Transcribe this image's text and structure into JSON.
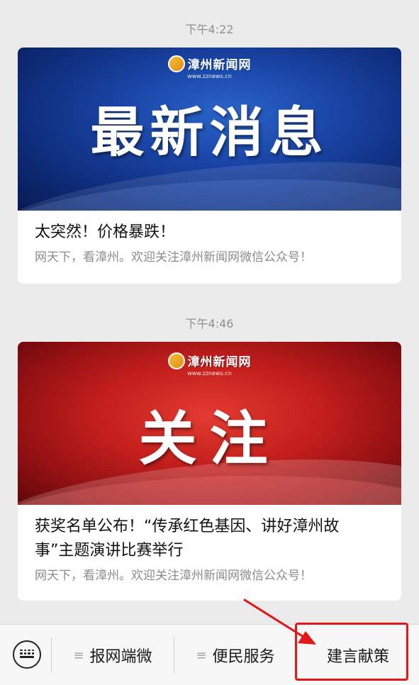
{
  "messages": [
    {
      "time": "下午4:22",
      "logo_text": "漳州新闻网",
      "logo_sub": "www.zznews.cn",
      "banner_text": "最新消息",
      "title": "太突然！价格暴跌！",
      "desc": "网天下，看漳州。欢迎关注漳州新闻网微信公众号！",
      "theme": "blue"
    },
    {
      "time": "下午4:46",
      "logo_text": "漳州新闻网",
      "logo_sub": "www.zznews.cn",
      "banner_text": "关注",
      "title_line1": "获奖名单公布！“传承红色基因、讲好漳州故",
      "title_line2": "事”主题演讲比赛举行",
      "desc": "网天下，看漳州。欢迎关注漳州新闻网微信公众号！",
      "theme": "red"
    }
  ],
  "menu": {
    "keyboard_icon": "keyboard-icon",
    "items": [
      {
        "label": "报网端微",
        "icon": "menu-lines-icon"
      },
      {
        "label": "便民服务",
        "icon": "menu-lines-icon"
      },
      {
        "label": "建言献策"
      }
    ],
    "hamburger_glyph": "≡"
  },
  "annotation": {
    "color": "#e4161a"
  }
}
